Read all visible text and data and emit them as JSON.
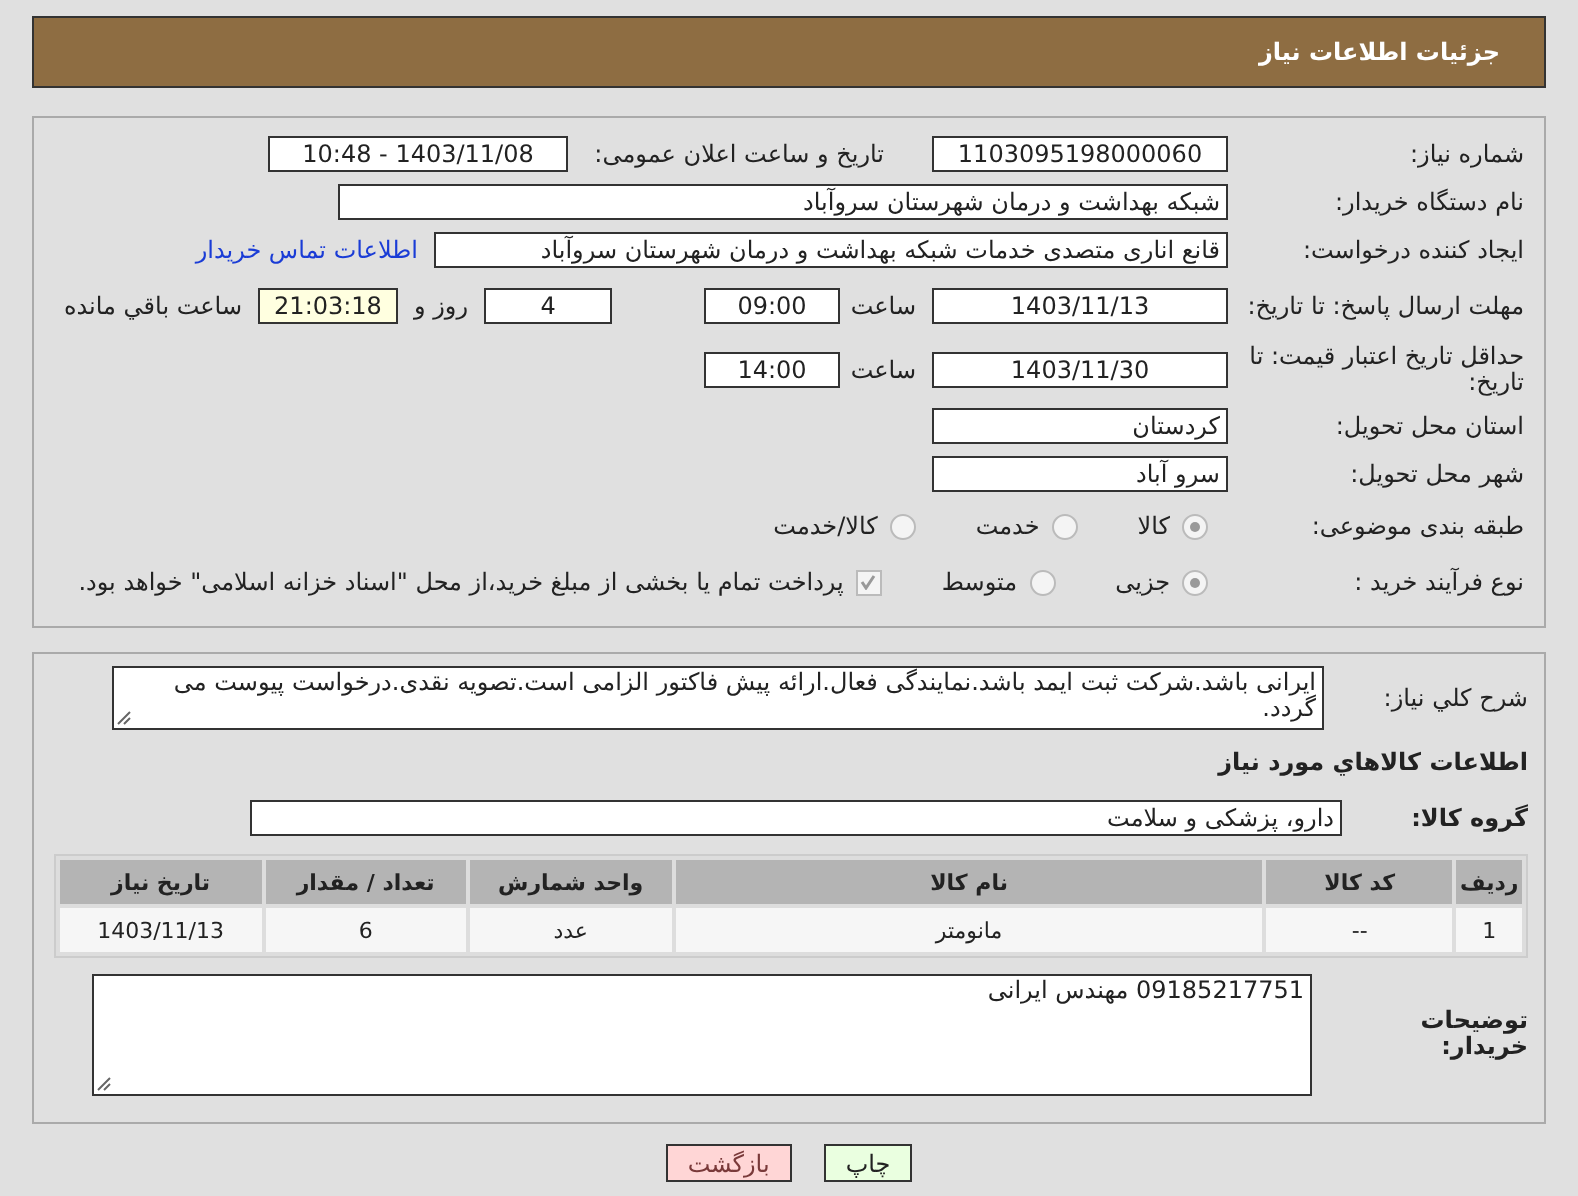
{
  "header": {
    "title": "جزئیات اطلاعات نیاز"
  },
  "details": {
    "need_number": {
      "label": "شماره نیاز:",
      "value": "1103095198000060"
    },
    "announce": {
      "label": "تاریخ و ساعت اعلان عمومی:",
      "value": "1403/11/08 - 10:48"
    },
    "buyer_org": {
      "label": "نام دستگاه خریدار:",
      "value": "شبکه بهداشت و درمان شهرستان سروآباد"
    },
    "requester": {
      "label": "ایجاد کننده درخواست:",
      "value": "قانع اناری متصدی خدمات شبکه بهداشت و درمان شهرستان سروآباد",
      "link": "اطلاعات تماس خریدار"
    },
    "deadline": {
      "label": "مهلت ارسال پاسخ: تا تاریخ:",
      "date": "1403/11/13",
      "time_label": "ساعت",
      "time": "09:00",
      "days": "4",
      "days_label": "روز و",
      "remaining": "21:03:18",
      "remaining_label": "ساعت باقي مانده"
    },
    "price_validity": {
      "label": "حداقل تاریخ اعتبار قیمت: تا تاریخ:",
      "date": "1403/11/30",
      "time_label": "ساعت",
      "time": "14:00"
    },
    "province": {
      "label": "استان محل تحویل:",
      "value": "کردستان"
    },
    "city": {
      "label": "شهر محل تحویل:",
      "value": "سرو آباد"
    },
    "category": {
      "label": "طبقه بندی موضوعی:",
      "options": [
        {
          "label": "کالا",
          "selected": true
        },
        {
          "label": "خدمت",
          "selected": false
        },
        {
          "label": "کالا/خدمت",
          "selected": false
        }
      ]
    },
    "process": {
      "label": "نوع فرآیند خرید :",
      "options": [
        {
          "label": "جزیی",
          "selected": true
        },
        {
          "label": "متوسط",
          "selected": false
        }
      ],
      "payment": {
        "checked": true,
        "label": "پرداخت تمام یا بخشی از مبلغ خرید،از محل \"اسناد خزانه اسلامی\" خواهد بود."
      }
    }
  },
  "needs": {
    "description": {
      "label": "شرح کلي نیاز:",
      "value": "ایرانی باشد.شرکت ثبت ایمد باشد.نمایندگی فعال.ارائه پیش فاکتور الزامی است.تصویه نقدی.درخواست پیوست می گردد."
    },
    "goods_heading": "اطلاعات کالاهاي مورد نیاز",
    "group": {
      "label": "گروه کالا:",
      "value": "دارو، پزشکی و سلامت"
    },
    "table": {
      "columns": [
        "ردیف",
        "کد کالا",
        "نام کالا",
        "واحد شمارش",
        "تعداد / مقدار",
        "تاریخ نیاز"
      ],
      "rows": [
        [
          "1",
          "--",
          "مانومتر",
          "عدد",
          "6",
          "1403/11/13"
        ]
      ]
    },
    "buyer_notes": {
      "label": "توضیحات خریدار:",
      "value": "09185217751 مهندس ایرانی"
    }
  },
  "buttons": [
    {
      "kind": "print",
      "label": "چاپ"
    },
    {
      "kind": "back",
      "label": "بازگشت"
    }
  ]
}
